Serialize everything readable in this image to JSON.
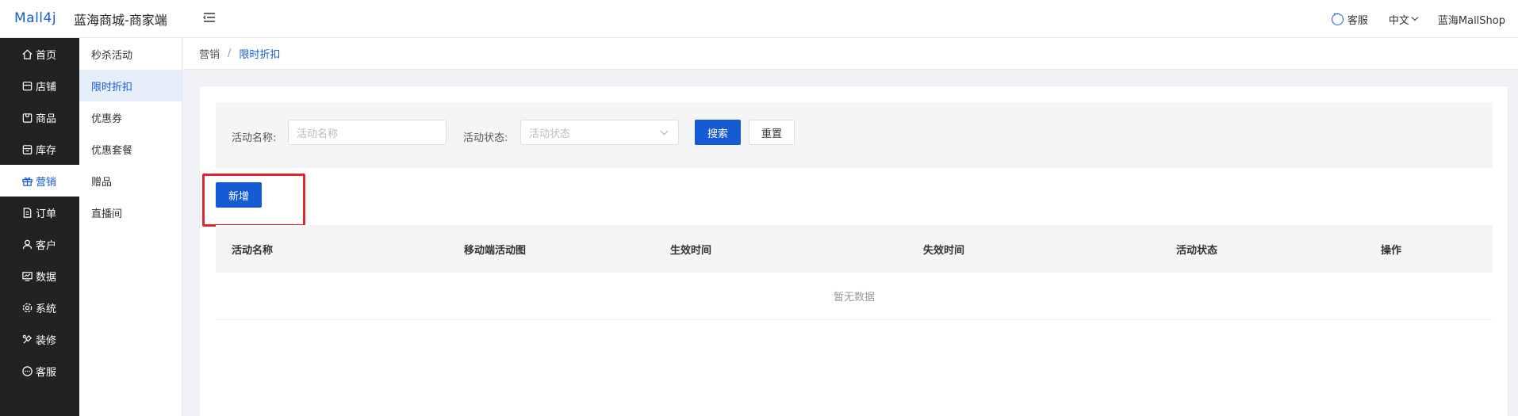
{
  "header": {
    "logo": "Mall4j",
    "shop_title": "蓝海商城-商家端",
    "service_label": "客服",
    "language_label": "中文",
    "username": "蓝海MallShop"
  },
  "sidebar": {
    "items": [
      {
        "label": "首页",
        "icon": "home-icon"
      },
      {
        "label": "店铺",
        "icon": "store-icon"
      },
      {
        "label": "商品",
        "icon": "product-icon"
      },
      {
        "label": "库存",
        "icon": "inventory-icon"
      },
      {
        "label": "营销",
        "icon": "gift-icon"
      },
      {
        "label": "订单",
        "icon": "order-icon"
      },
      {
        "label": "客户",
        "icon": "customer-icon"
      },
      {
        "label": "数据",
        "icon": "data-icon"
      },
      {
        "label": "系统",
        "icon": "settings-icon"
      },
      {
        "label": "装修",
        "icon": "decorate-icon"
      },
      {
        "label": "客服",
        "icon": "service-icon"
      }
    ],
    "active_index": 4
  },
  "subsidebar": {
    "items": [
      "秒杀活动",
      "限时折扣",
      "优惠券",
      "优惠套餐",
      "赠品",
      "直播间"
    ],
    "active_index": 1
  },
  "breadcrumb": {
    "parent": "营销",
    "separator": "/",
    "current": "限时折扣"
  },
  "search": {
    "name_label": "活动名称:",
    "name_placeholder": "活动名称",
    "status_label": "活动状态:",
    "status_placeholder": "活动状态",
    "search_button": "搜索",
    "reset_button": "重置"
  },
  "actions": {
    "add_button": "新增"
  },
  "table": {
    "columns": [
      "活动名称",
      "移动端活动图",
      "生效时间",
      "失效时间",
      "活动状态",
      "操作"
    ],
    "empty_text": "暂无数据"
  },
  "colors": {
    "primary": "#155bd4",
    "sidebar_bg": "#222222",
    "highlight": "#e5252a"
  }
}
